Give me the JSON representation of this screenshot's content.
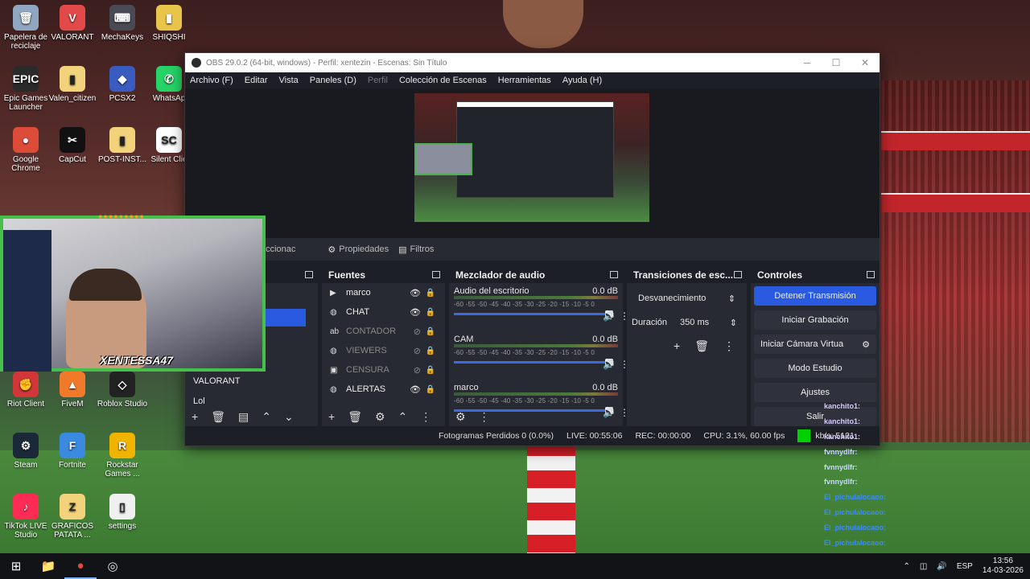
{
  "desktop": {
    "icons": [
      {
        "label": "Papelera de reciclaje",
        "glyph": "🗑",
        "color": "#8fa7c0"
      },
      {
        "label": "VALORANT",
        "glyph": "V",
        "color": "#e24a4a"
      },
      {
        "label": "MechaKeys",
        "glyph": "⌨",
        "color": "#4a4a55"
      },
      {
        "label": "SHIQSHI",
        "glyph": "▮",
        "color": "#e8c54a"
      },
      {
        "label": "Epic Games Launcher",
        "glyph": "EPIC",
        "color": "#2a2a2a"
      },
      {
        "label": "Valen_citizen",
        "glyph": "▮",
        "color": "#f2d27a"
      },
      {
        "label": "PCSX2",
        "glyph": "◆",
        "color": "#3a5cc0"
      },
      {
        "label": "WhatsAp",
        "glyph": "✆",
        "color": "#25d366"
      },
      {
        "label": "Google Chrome",
        "glyph": "●",
        "color": "#dd4b39"
      },
      {
        "label": "CapCut",
        "glyph": "✂",
        "color": "#111111"
      },
      {
        "label": "POST-INST...",
        "glyph": "▮",
        "color": "#f2d27a"
      },
      {
        "label": "Silent Clie",
        "glyph": "SC",
        "color": "#ffffff"
      },
      {
        "label": "Riot Client",
        "glyph": "✊",
        "color": "#d13639"
      },
      {
        "label": "FiveM",
        "glyph": "▲",
        "color": "#f07a2a"
      },
      {
        "label": "Roblox Studio",
        "glyph": "◇",
        "color": "#222222"
      },
      {
        "label": "Steam",
        "glyph": "⚙",
        "color": "#1b2838"
      },
      {
        "label": "Fortnite",
        "glyph": "F",
        "color": "#3a8ae0"
      },
      {
        "label": "Rockstar Games ...",
        "glyph": "R",
        "color": "#f0b400"
      },
      {
        "label": "TikTok LIVE Studio",
        "glyph": "♪",
        "color": "#fe2c55"
      },
      {
        "label": "GRAFICOS PATATA ...",
        "glyph": "Z",
        "color": "#f2d27a"
      },
      {
        "label": "settings",
        "glyph": "▯",
        "color": "#f0f0f0"
      }
    ]
  },
  "obs": {
    "title": "OBS 29.0.2 (64-bit, windows) - Perfil: xentezin - Escenas: Sin Título",
    "window_controls": [
      "─",
      "☐",
      "✕"
    ],
    "menu": [
      "Archivo (F)",
      "Editar",
      "Vista",
      "Paneles (D)",
      "Perfil",
      "Colección de Escenas",
      "Herramientas",
      "Ayuda (H)"
    ],
    "toolbar": {
      "selection_label": "eccionac",
      "properties": "Propiedades",
      "filters": "Filtros"
    },
    "scenes": {
      "items": [
        "VALORANT",
        "Lol"
      ]
    },
    "sources": {
      "title": "Fuentes",
      "items": [
        {
          "name": "marco",
          "icon": "▶",
          "visible": true
        },
        {
          "name": "CHAT",
          "icon": "◍",
          "visible": true
        },
        {
          "name": "CONTADOR",
          "icon": "ab",
          "visible": false
        },
        {
          "name": "VIEWERS",
          "icon": "◍",
          "visible": false
        },
        {
          "name": "CENSURA",
          "icon": "▣",
          "visible": false
        },
        {
          "name": "ALERTAS",
          "icon": "◍",
          "visible": true
        }
      ]
    },
    "mixer": {
      "title": "Mezclador de audio",
      "ticks": "-60 -55 -50 -45 -40 -35 -30 -25 -20 -15 -10 -5 0",
      "channels": [
        {
          "name": "Audio del escritorio",
          "db": "0.0 dB",
          "level": 0.95
        },
        {
          "name": "CAM",
          "db": "0.0 dB",
          "level": 0.95
        },
        {
          "name": "marco",
          "db": "0.0 dB",
          "level": 0.95
        }
      ]
    },
    "transitions": {
      "title": "Transiciones de esc...",
      "type": "Desvanecimiento",
      "duration_label": "Duración",
      "duration": "350 ms"
    },
    "controls": {
      "title": "Controles",
      "stop_stream": "Detener Transmisión",
      "start_record": "Iniciar Grabación",
      "virtual_cam": "Iniciar Cámara Virtua",
      "studio_mode": "Modo Estudio",
      "settings": "Ajustes",
      "exit": "Salir"
    },
    "status": {
      "dropped": "Fotogramas Perdidos 0 (0.0%)",
      "live": "LIVE: 00:55:06",
      "rec": "REC: 00:00:00",
      "cpu": "CPU: 3.1%, 60.00 fps",
      "bitrate": "kb/s: 5121"
    }
  },
  "webcam": {
    "overlay_name": "XENTESSA47"
  },
  "chat": [
    {
      "user": "kanchito1:",
      "color": "#d7c8ff"
    },
    {
      "user": "kanchito1:",
      "color": "#d7c8ff"
    },
    {
      "user": "kanchito1:",
      "color": "#d7c8ff"
    },
    {
      "user": "fvnnydlfr:",
      "color": "#c8d8ff"
    },
    {
      "user": "fvnnydlfr:",
      "color": "#c8d8ff"
    },
    {
      "user": "fvnnydlfr:",
      "color": "#c8d8ff"
    },
    {
      "user": "El_pichulalocaoo:",
      "color": "#3a8cff"
    },
    {
      "user": "El_pichulalocaoo:",
      "color": "#3a8cff"
    },
    {
      "user": "El_pichulalocaoo:",
      "color": "#3a8cff"
    },
    {
      "user": "El_pichulalocaoo:",
      "color": "#3a8cff"
    },
    {
      "user": "El_pichulalocaoo:",
      "color": "#3a8cff"
    }
  ],
  "taskbar": {
    "apps": [
      "⊞",
      "📁",
      "●",
      "◎"
    ],
    "tray_lang": "ESP",
    "time": "13:56",
    "date": "14-03-2026"
  }
}
